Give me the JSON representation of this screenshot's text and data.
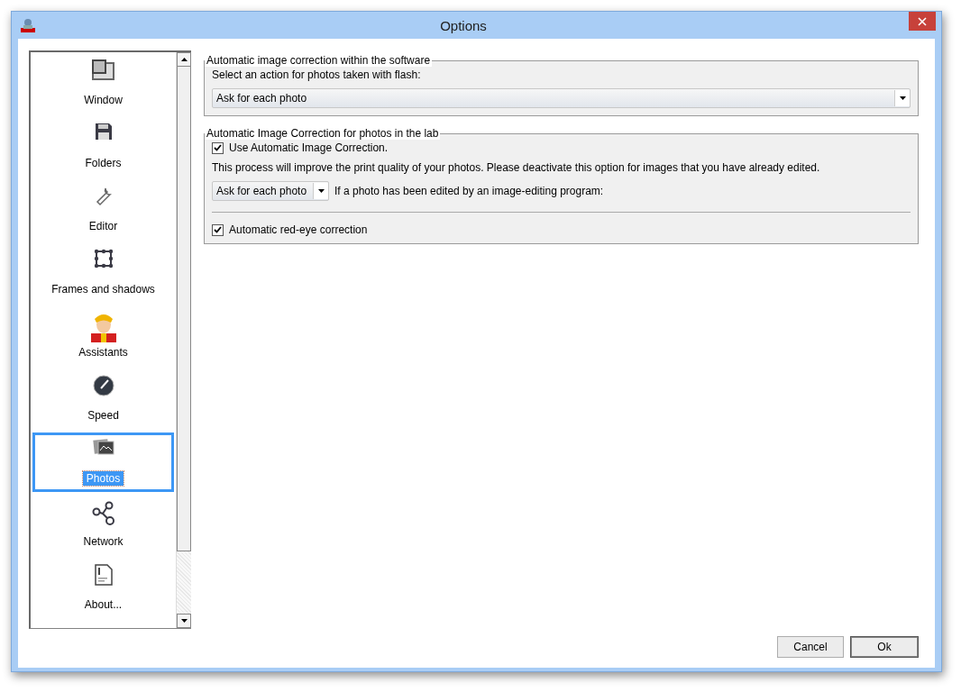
{
  "window": {
    "title": "Options"
  },
  "sidebar": {
    "items": [
      {
        "label": "Window",
        "selected": false
      },
      {
        "label": "Folders",
        "selected": false
      },
      {
        "label": "Editor",
        "selected": false
      },
      {
        "label": "Frames and shadows",
        "selected": false
      },
      {
        "label": "Assistants",
        "selected": false
      },
      {
        "label": "Speed",
        "selected": false
      },
      {
        "label": "Photos",
        "selected": true
      },
      {
        "label": "Network",
        "selected": false
      },
      {
        "label": "About...",
        "selected": false
      }
    ]
  },
  "groups": [
    {
      "title": "Automatic image correction within the software",
      "rows": [
        {
          "kind": "label",
          "text": "Select an action for photos taken with flash:"
        },
        {
          "kind": "wide_select",
          "value": "Ask for each photo"
        }
      ]
    },
    {
      "title": "Automatic Image Correction for photos in the lab",
      "rows": [
        {
          "kind": "checkbox",
          "text": "Use Automatic Image Correction.",
          "checked": true
        },
        {
          "kind": "label",
          "text": "This process will improve the print quality of your photos. Please deactivate this option for images that you have already edited."
        },
        {
          "kind": "select_with_label",
          "value": "Ask for each photo",
          "text": "If a photo has been edited by an image-editing program:"
        },
        {
          "kind": "divider"
        },
        {
          "kind": "checkbox",
          "text": "Automatic red-eye correction",
          "checked": true
        }
      ]
    }
  ],
  "buttons": [
    {
      "label": "Cancel",
      "default": false
    },
    {
      "label": "Ok",
      "default": true
    }
  ]
}
